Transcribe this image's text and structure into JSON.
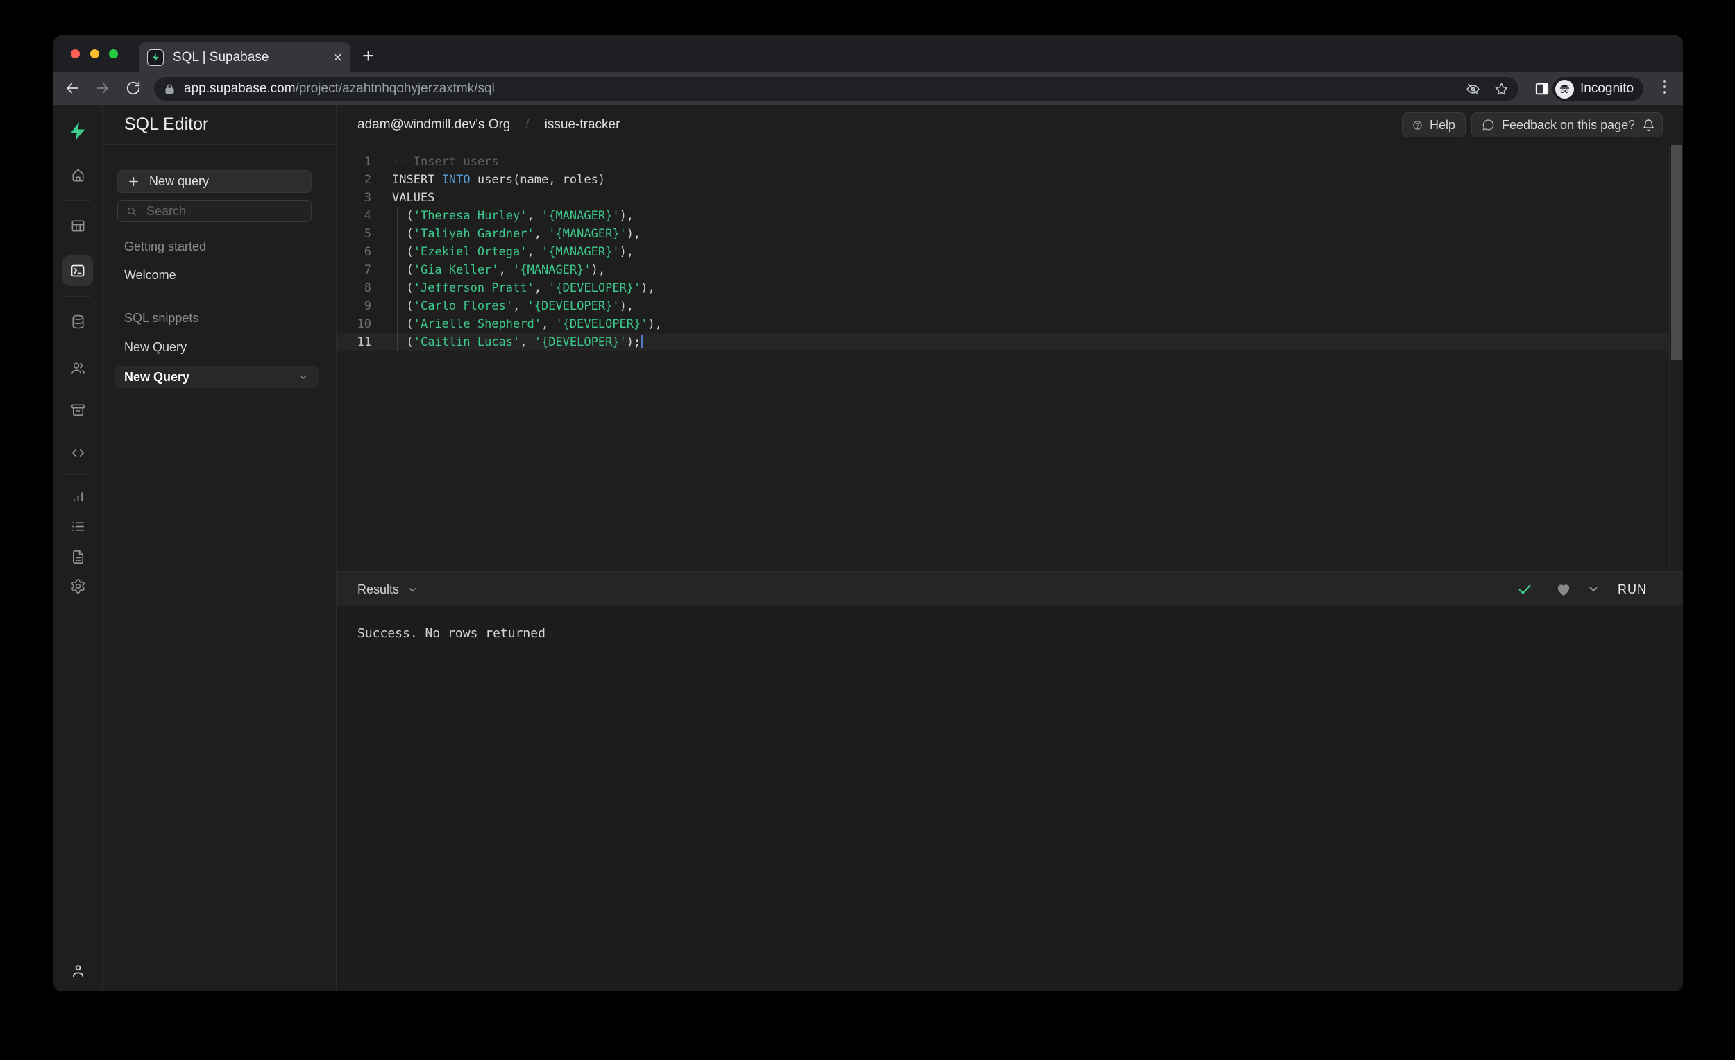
{
  "chrome": {
    "tab_title": "SQL | Supabase",
    "url": {
      "domain": "app.supabase.com",
      "path": "/project/azahtnhqohyjerzaxtmk/sql"
    },
    "incognito_label": "Incognito"
  },
  "header": {
    "breadcrumb": {
      "org": "adam@windmill.dev's Org",
      "separator": "/",
      "project": "issue-tracker"
    },
    "help_label": "Help",
    "feedback_label": "Feedback on this page?"
  },
  "sidebar": {
    "title": "SQL Editor",
    "new_query_button": "New query",
    "search_placeholder": "Search",
    "sections": [
      {
        "label": "Getting started",
        "items": [
          {
            "label": "Welcome",
            "active": false
          }
        ]
      },
      {
        "label": "SQL snippets",
        "items": [
          {
            "label": "New Query",
            "active": false
          },
          {
            "label": "New Query",
            "active": true
          }
        ]
      }
    ]
  },
  "rail": {
    "items": [
      "home",
      "table-editor",
      "sql-editor",
      "database",
      "authentication",
      "storage",
      "edge-functions",
      "reports",
      "logs",
      "api-docs",
      "settings",
      "account"
    ]
  },
  "editor": {
    "lines": [
      {
        "n": 1,
        "tokens": [
          {
            "type": "comment",
            "text": "-- Insert users"
          }
        ]
      },
      {
        "n": 2,
        "tokens": [
          {
            "type": "plain",
            "text": "INSERT "
          },
          {
            "type": "keyword",
            "text": "INTO"
          },
          {
            "type": "plain",
            "text": " users(name, roles)"
          }
        ]
      },
      {
        "n": 3,
        "tokens": [
          {
            "type": "plain",
            "text": "VALUES"
          }
        ]
      },
      {
        "n": 4,
        "tokens": [
          {
            "type": "plain",
            "text": "  ("
          },
          {
            "type": "string",
            "text": "'Theresa Hurley'"
          },
          {
            "type": "plain",
            "text": ", "
          },
          {
            "type": "string",
            "text": "'{MANAGER}'"
          },
          {
            "type": "plain",
            "text": "),"
          }
        ]
      },
      {
        "n": 5,
        "tokens": [
          {
            "type": "plain",
            "text": "  ("
          },
          {
            "type": "string",
            "text": "'Taliyah Gardner'"
          },
          {
            "type": "plain",
            "text": ", "
          },
          {
            "type": "string",
            "text": "'{MANAGER}'"
          },
          {
            "type": "plain",
            "text": "),"
          }
        ]
      },
      {
        "n": 6,
        "tokens": [
          {
            "type": "plain",
            "text": "  ("
          },
          {
            "type": "string",
            "text": "'Ezekiel Ortega'"
          },
          {
            "type": "plain",
            "text": ", "
          },
          {
            "type": "string",
            "text": "'{MANAGER}'"
          },
          {
            "type": "plain",
            "text": "),"
          }
        ]
      },
      {
        "n": 7,
        "tokens": [
          {
            "type": "plain",
            "text": "  ("
          },
          {
            "type": "string",
            "text": "'Gia Keller'"
          },
          {
            "type": "plain",
            "text": ", "
          },
          {
            "type": "string",
            "text": "'{MANAGER}'"
          },
          {
            "type": "plain",
            "text": "),"
          }
        ]
      },
      {
        "n": 8,
        "tokens": [
          {
            "type": "plain",
            "text": "  ("
          },
          {
            "type": "string",
            "text": "'Jefferson Pratt'"
          },
          {
            "type": "plain",
            "text": ", "
          },
          {
            "type": "string",
            "text": "'{DEVELOPER}'"
          },
          {
            "type": "plain",
            "text": "),"
          }
        ]
      },
      {
        "n": 9,
        "tokens": [
          {
            "type": "plain",
            "text": "  ("
          },
          {
            "type": "string",
            "text": "'Carlo Flores'"
          },
          {
            "type": "plain",
            "text": ", "
          },
          {
            "type": "string",
            "text": "'{DEVELOPER}'"
          },
          {
            "type": "plain",
            "text": "),"
          }
        ]
      },
      {
        "n": 10,
        "tokens": [
          {
            "type": "plain",
            "text": "  ("
          },
          {
            "type": "string",
            "text": "'Arielle Shepherd'"
          },
          {
            "type": "plain",
            "text": ", "
          },
          {
            "type": "string",
            "text": "'{DEVELOPER}'"
          },
          {
            "type": "plain",
            "text": "),"
          }
        ]
      },
      {
        "n": 11,
        "current": true,
        "cursor": true,
        "tokens": [
          {
            "type": "plain",
            "text": "  ("
          },
          {
            "type": "string",
            "text": "'Caitlin Lucas'"
          },
          {
            "type": "plain",
            "text": ", "
          },
          {
            "type": "string",
            "text": "'{DEVELOPER}'"
          },
          {
            "type": "plain",
            "text": ");"
          }
        ]
      }
    ]
  },
  "results": {
    "label": "Results",
    "message": "Success. No rows returned",
    "run_label": "RUN"
  },
  "colors": {
    "accent_green": "#3ecf8e",
    "keyword_blue": "#569cd6",
    "string_green": "#3dc98b",
    "traffic_red": "#ff5f57",
    "traffic_yellow": "#febc2e",
    "traffic_green": "#28c840"
  }
}
